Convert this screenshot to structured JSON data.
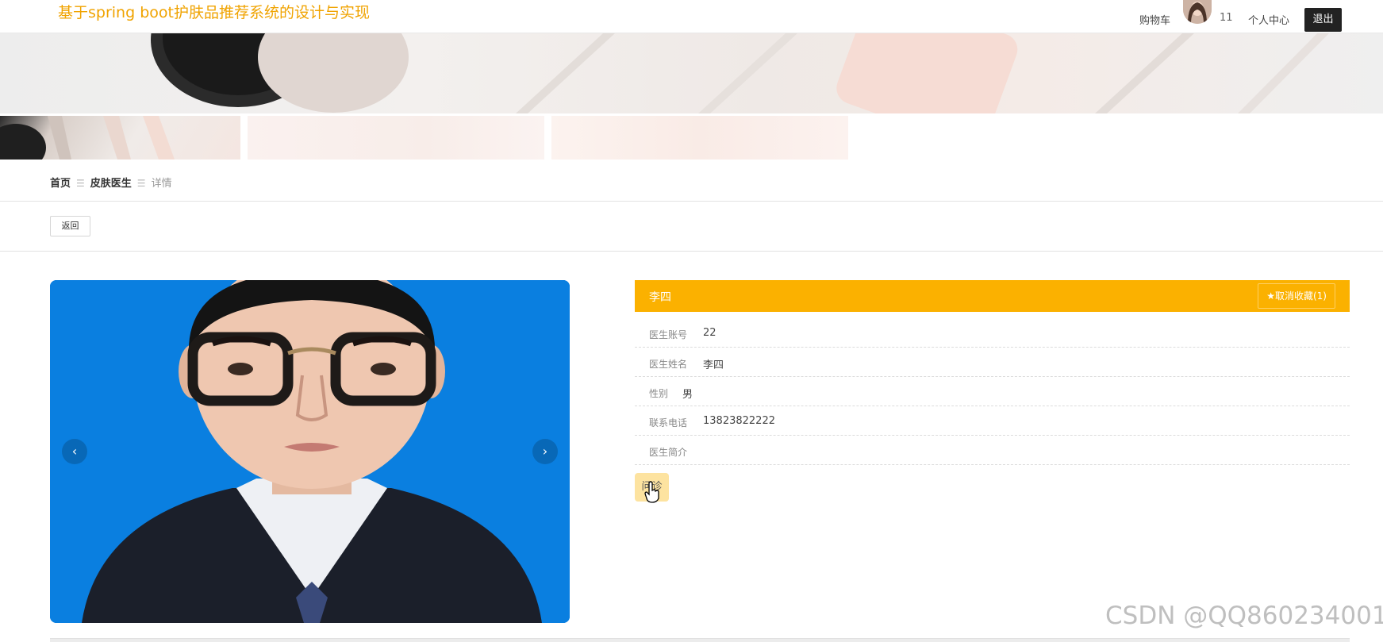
{
  "header": {
    "site_title": "基于spring boot护肤品推荐系统的设计与实现",
    "cart": "购物车",
    "username": "11",
    "profile": "个人中心",
    "logout": "退出"
  },
  "breadcrumb": {
    "home": "首页",
    "sep": "☰",
    "category": "皮肤医生",
    "current": "详情"
  },
  "back_button": "返回",
  "carousel": {
    "prev": "‹",
    "next": "›"
  },
  "detail": {
    "name": "李四",
    "favorite_button": "★取消收藏(1)",
    "fields": [
      {
        "label": "医生账号",
        "value": "22"
      },
      {
        "label": "医生姓名",
        "value": "李四"
      },
      {
        "label": "性别",
        "value": "男"
      },
      {
        "label": "联系电话",
        "value": "13823822222"
      },
      {
        "label": "医生简介",
        "value": ""
      }
    ],
    "consult_button": "问诊"
  },
  "watermark": "CSDN @QQ860234001",
  "colors": {
    "accent": "#fbb100",
    "title": "#f0a300",
    "photo_bg": "#0a7fe0"
  }
}
